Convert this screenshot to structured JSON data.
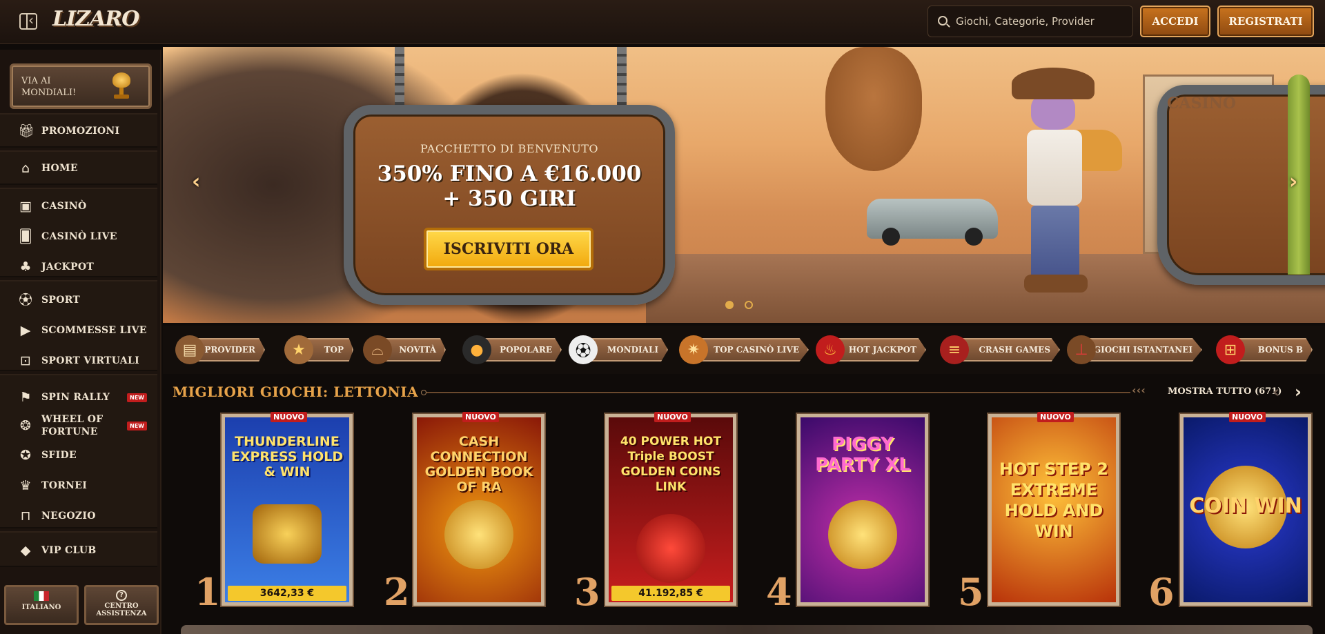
{
  "header": {
    "logo": "LIZARO",
    "search_placeholder": "Giochi, Categorie, Provider",
    "login": "ACCEDI",
    "register": "REGISTRATI"
  },
  "sidebar": {
    "promo_card": "VIA AI MONDIALI!",
    "items": [
      {
        "label": "PROMOZIONI",
        "icon": "gift-icon"
      },
      {
        "label": "HOME",
        "icon": "home-icon"
      },
      {
        "label": "CASINÒ",
        "icon": "slot-machine-icon"
      },
      {
        "label": "CASINÒ LIVE",
        "icon": "cards-icon"
      },
      {
        "label": "JACKPOT",
        "icon": "clover-icon"
      },
      {
        "label": "SPORT",
        "icon": "football-icon"
      },
      {
        "label": "SCOMMESSE LIVE",
        "icon": "play-icon"
      },
      {
        "label": "SPORT VIRTUALI",
        "icon": "virtual-sport-icon"
      },
      {
        "label": "SPIN RALLY",
        "icon": "racing-flag-icon",
        "badge": "NEW"
      },
      {
        "label": "WHEEL OF FORTUNE",
        "icon": "wheel-icon",
        "badge": "NEW"
      },
      {
        "label": "SFIDE",
        "icon": "medal-icon"
      },
      {
        "label": "TORNEI",
        "icon": "trophy-icon"
      },
      {
        "label": "NEGOZIO",
        "icon": "shop-bag-icon"
      },
      {
        "label": "VIP CLUB",
        "icon": "diamond-icon"
      }
    ],
    "language": "ITALIANO",
    "support": "CENTRO ASSISTENZA"
  },
  "banner": {
    "pre": "PACCHETTO DI BENVENUTO",
    "headline_line1": "350% FINO A €16.000",
    "headline_line2": "+ 350 GIRI",
    "cta": "ISCRIVITI ORA",
    "slide_count": 2,
    "active_slide": 1
  },
  "categories": [
    {
      "label": "PROVIDER",
      "icon": "book-icon"
    },
    {
      "label": "TOP",
      "icon": "star-badge-icon"
    },
    {
      "label": "NOVITÀ",
      "icon": "cowboy-hat-icon"
    },
    {
      "label": "POPOLARE",
      "icon": "bomb-icon"
    },
    {
      "label": "MONDIALI",
      "icon": "soccer-ball-icon"
    },
    {
      "label": "TOP CASINÒ LIVE",
      "icon": "sheriff-star-icon"
    },
    {
      "label": "HOT JACKPOT",
      "icon": "chili-icon"
    },
    {
      "label": "CRASH GAMES",
      "icon": "dynamite-icon"
    },
    {
      "label": "GIOCHI ISTANTANEI",
      "icon": "joystick-icon"
    },
    {
      "label": "BONUS B",
      "icon": "gift-box-icon"
    }
  ],
  "section": {
    "title": "MIGLIORI GIOCHI: LETTONIA",
    "show_all": "MOSTRA TUTTO (671)"
  },
  "games": [
    {
      "rank": "1",
      "title": "THUNDERLINE EXPRESS HOLD & WIN",
      "badge": "NUOVO",
      "jackpot": "3642,33 €",
      "bg1": "#1c3fae",
      "bg2": "#3c7fe6"
    },
    {
      "rank": "2",
      "title": "CASH CONNECTION GOLDEN BOOK OF RA",
      "badge": "NUOVO",
      "jackpot": "",
      "bg1": "#8a1808",
      "bg2": "#f29a10"
    },
    {
      "rank": "3",
      "title": "40 POWER HOT Triple BOOST GOLDEN COINS LINK",
      "badge": "NUOVO",
      "jackpot": "41.192,85 €",
      "bg1": "#5a0a0a",
      "bg2": "#c81e1e"
    },
    {
      "rank": "4",
      "title": "PIGGY PARTY XL",
      "badge": "",
      "jackpot": "",
      "bg1": "#3a0a6a",
      "bg2": "#c02fa8"
    },
    {
      "rank": "5",
      "title": "HOT STEP 2 EXTREME HOLD AND WIN",
      "badge": "NUOVO",
      "jackpot": "",
      "bg1": "#b8320a",
      "bg2": "#ffc23a"
    },
    {
      "rank": "6",
      "title": "COIN WIN",
      "badge": "NUOVO",
      "jackpot": "",
      "bg1": "#0a1a6a",
      "bg2": "#2a3ad0"
    }
  ]
}
